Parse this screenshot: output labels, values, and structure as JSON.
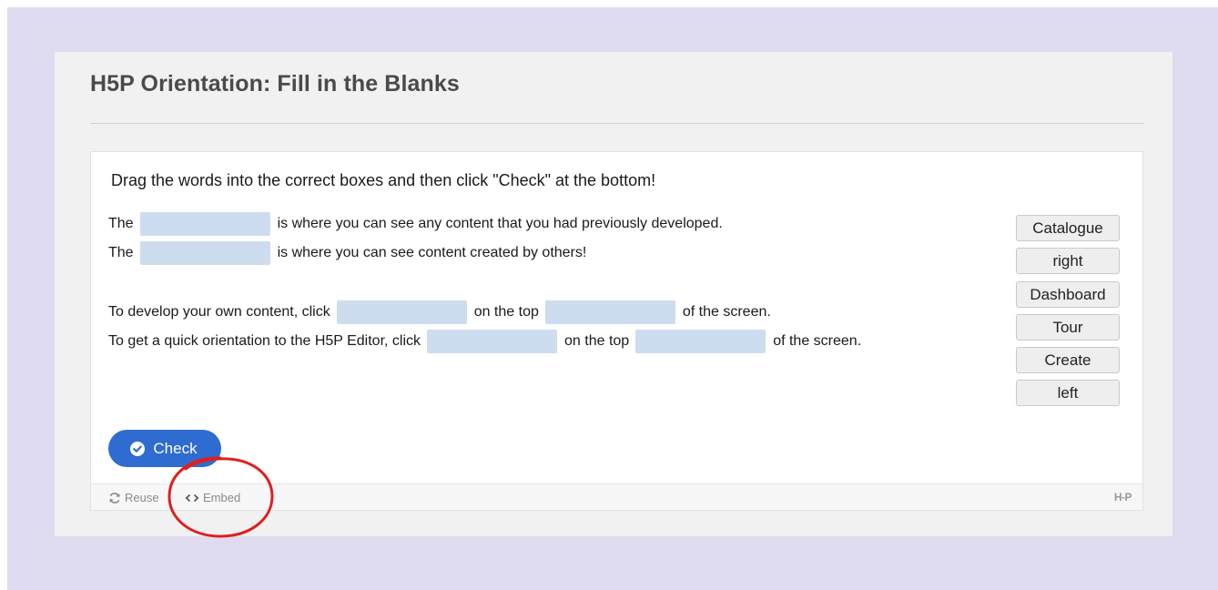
{
  "page": {
    "title": "H5P Orientation: Fill in the Blanks"
  },
  "activity": {
    "instructions": "Drag the words into the correct boxes and then click \"Check\" at the bottom!",
    "sentences": [
      {
        "parts": [
          "The",
          "is where you can see any content that you had previously developed."
        ]
      },
      {
        "parts": [
          "The",
          "is where you can see content created by others!"
        ]
      },
      {
        "parts": [
          "To develop your own content, click",
          "on the top",
          "of the screen."
        ]
      },
      {
        "parts": [
          "To get a quick orientation to the H5P Editor, click",
          "on the top",
          "of the screen."
        ]
      }
    ],
    "word_bank": [
      "Catalogue",
      "right",
      "Dashboard",
      "Tour",
      "Create",
      "left"
    ],
    "check_label": "Check"
  },
  "footer": {
    "reuse_label": "Reuse",
    "embed_label": "Embed",
    "logo_text": "H-P"
  },
  "colors": {
    "backdrop": "#dedcee",
    "blank": "#cedcf0",
    "check_button": "#2f6cd1",
    "annotation_circle": "#e01e1e"
  },
  "icons": {
    "check": "check-circle-icon",
    "reuse": "refresh-icon",
    "embed": "code-brackets-icon"
  }
}
